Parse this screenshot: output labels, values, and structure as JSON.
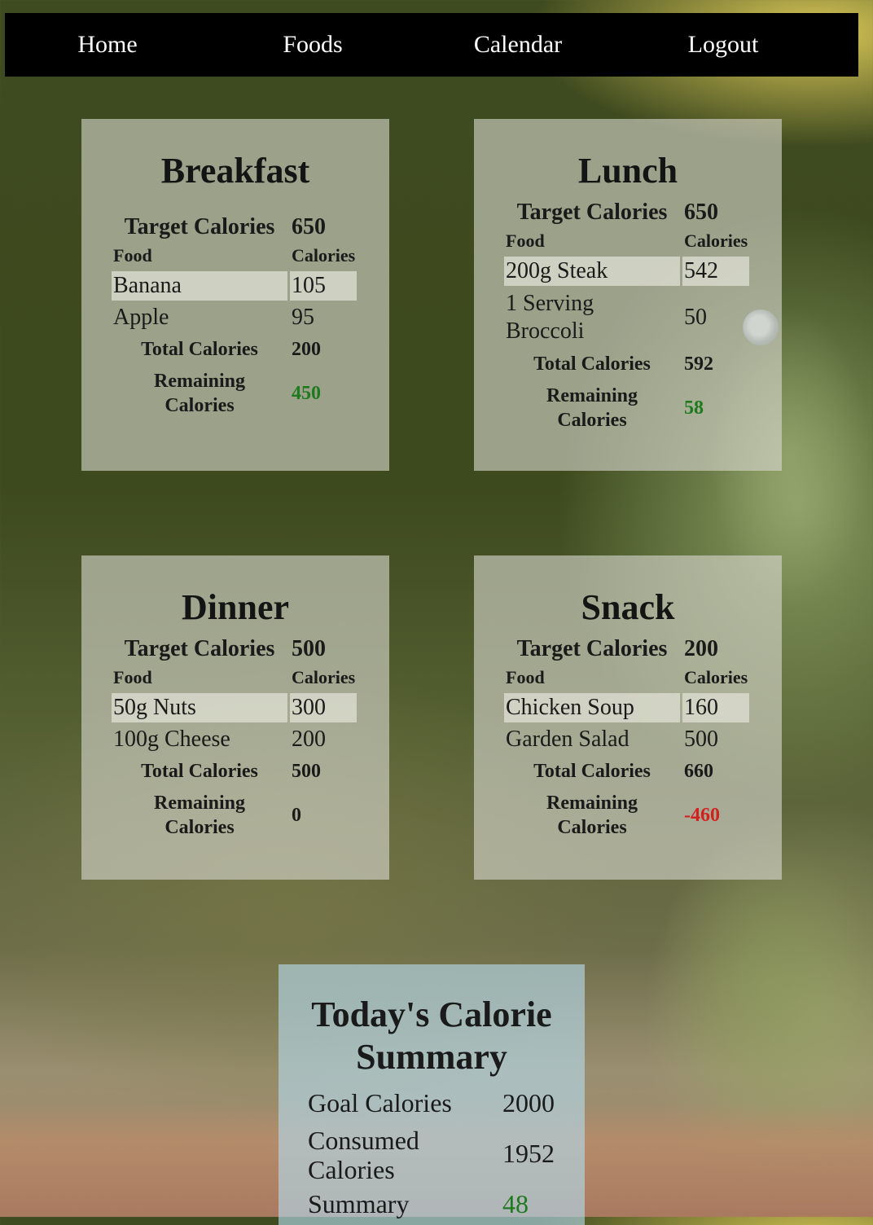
{
  "nav": {
    "home": "Home",
    "foods": "Foods",
    "calendar": "Calendar",
    "logout": "Logout"
  },
  "meals": {
    "breakfast": {
      "title": "Breakfast",
      "target_label": "Target Calories",
      "target_value": "650",
      "food_header": "Food",
      "calories_header": "Calories",
      "items": [
        {
          "food": "Banana",
          "calories": "105"
        },
        {
          "food": "Apple",
          "calories": "95"
        }
      ],
      "total_label": "Total Calories",
      "total_value": "200",
      "remaining_label": "Remaining Calories",
      "remaining_value": "450"
    },
    "lunch": {
      "title": "Lunch",
      "target_label": "Target Calories",
      "target_value": "650",
      "food_header": "Food",
      "calories_header": "Calories",
      "items": [
        {
          "food": "200g Steak",
          "calories": "542"
        },
        {
          "food": "1 Serving Broccoli",
          "calories": "50"
        }
      ],
      "total_label": "Total Calories",
      "total_value": "592",
      "remaining_label": "Remaining Calories",
      "remaining_value": "58"
    },
    "dinner": {
      "title": "Dinner",
      "target_label": "Target Calories",
      "target_value": "500",
      "food_header": "Food",
      "calories_header": "Calories",
      "items": [
        {
          "food": "50g Nuts",
          "calories": "300"
        },
        {
          "food": "100g Cheese",
          "calories": "200"
        }
      ],
      "total_label": "Total Calories",
      "total_value": "500",
      "remaining_label": "Remaining Calories",
      "remaining_value": "0"
    },
    "snack": {
      "title": "Snack",
      "target_label": "Target Calories",
      "target_value": "200",
      "food_header": "Food",
      "calories_header": "Calories",
      "items": [
        {
          "food": "Chicken Soup",
          "calories": "160"
        },
        {
          "food": "Garden Salad",
          "calories": "500"
        }
      ],
      "total_label": "Total Calories",
      "total_value": "660",
      "remaining_label": "Remaining Calories",
      "remaining_value": "-460"
    }
  },
  "summary": {
    "title": "Today's Calorie Summary",
    "goal_label": "Goal Calories",
    "goal_value": "2000",
    "consumed_label": "Consumed Calories",
    "consumed_value": "1952",
    "summary_label": "Summary",
    "summary_value": "48"
  },
  "colors": {
    "positive": "#1f7a1f",
    "negative": "#d2201e",
    "nav_bg": "#000000"
  }
}
